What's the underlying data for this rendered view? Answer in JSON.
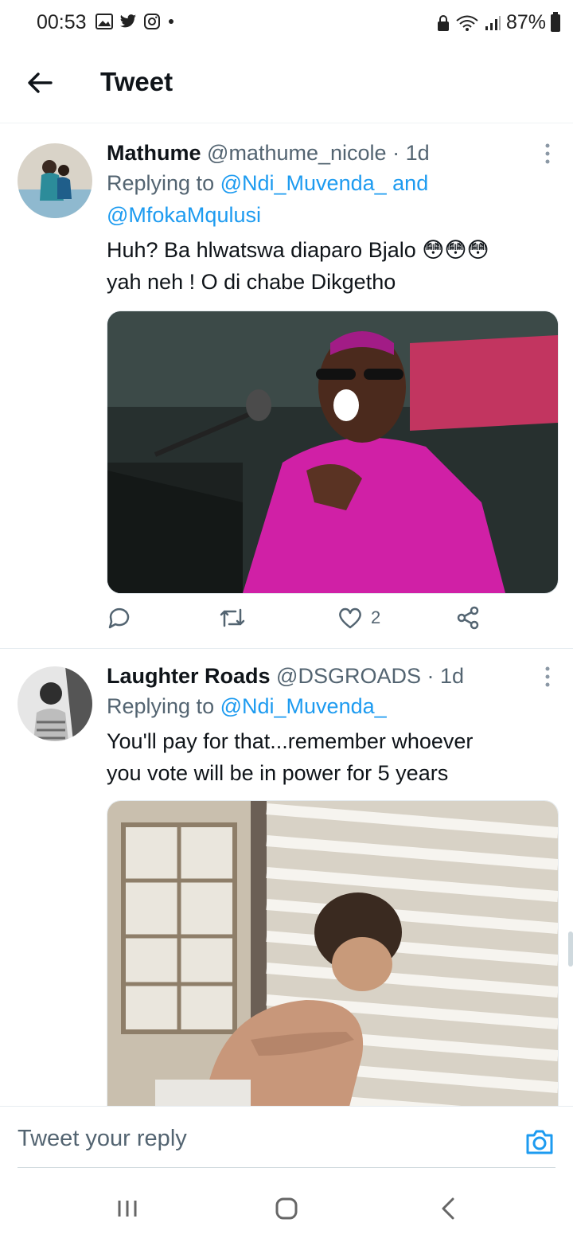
{
  "status_bar": {
    "time": "00:53",
    "battery": "87%",
    "left_icons": [
      "gallery-icon",
      "twitter-icon",
      "instagram-icon",
      "dot-icon"
    ],
    "right_icons": [
      "lock-icon",
      "wifi-icon",
      "signal-icon",
      "battery-icon"
    ]
  },
  "header": {
    "title": "Tweet",
    "back_icon": "arrow-left-icon"
  },
  "tweets": [
    {
      "name": "Mathume",
      "handle": "@mathume_nicole",
      "separator": "·",
      "time": "1d",
      "replying_prefix": "Replying to",
      "mention1": "@Ndi_Muvenda_",
      "and_word": "and",
      "mention2": "@MfokaMqulusi",
      "text_line1": "Huh? Ba hlwatswa diaparo Bjalo 😳😳😳",
      "text_line2": "yah neh ! O di chabe Dikgetho",
      "like_count": "2"
    },
    {
      "name": "Laughter Roads",
      "handle": "@DSGROADS",
      "separator": "·",
      "time": "1d",
      "replying_prefix": "Replying to",
      "mention1": "@Ndi_Muvenda_",
      "text_line1": "You'll pay for that...remember whoever",
      "text_line2": "you vote will be in power for 5 years"
    }
  ],
  "reply_bar": {
    "placeholder": "Tweet your reply",
    "camera_icon": "camera-icon"
  },
  "nav_bar": {
    "icons": [
      "recent-apps-icon",
      "home-icon",
      "back-icon"
    ]
  },
  "colors": {
    "link": "#1d9bf0",
    "secondary_text": "#536471",
    "primary_text": "#0f1419"
  }
}
